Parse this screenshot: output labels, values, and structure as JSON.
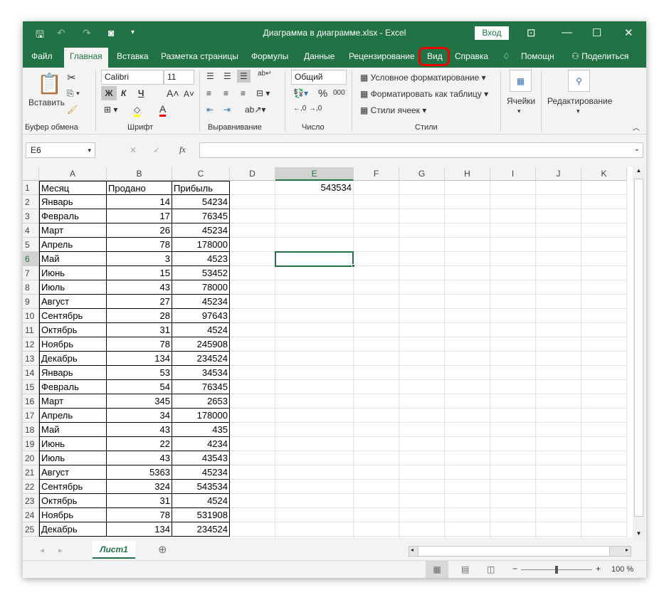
{
  "title": "Диаграмма в диаграмме.xlsx  -  Excel",
  "login": "Вход",
  "tabs": [
    "Файл",
    "Главная",
    "Вставка",
    "Разметка страницы",
    "Формулы",
    "Данные",
    "Рецензирование",
    "Вид",
    "Справка",
    "Помощн",
    "Поделиться"
  ],
  "ribbon": {
    "paste": "Вставить",
    "clipboard": "Буфер обмена",
    "font_name": "Calibri",
    "font_size": "11",
    "bold": "Ж",
    "italic": "К",
    "underline": "Ч",
    "font": "Шрифт",
    "alignment": "Выравнивание",
    "number_format": "Общий",
    "number": "Число",
    "percent": "%",
    "thousands": "000",
    "cond_format": "Условное форматирование",
    "format_table": "Форматировать как таблицу",
    "cell_styles": "Стили ячеек",
    "styles": "Стили",
    "cells": "Ячейки",
    "editing": "Редактирование"
  },
  "name_box": "E6",
  "fx": "fx",
  "columns": [
    "A",
    "B",
    "C",
    "D",
    "E",
    "F",
    "G",
    "H",
    "I",
    "J",
    "K"
  ],
  "header_row": [
    "Месяц",
    "Продано",
    "Прибыль"
  ],
  "rows": [
    [
      "Январь",
      14,
      54234
    ],
    [
      "Февраль",
      17,
      76345
    ],
    [
      "Март",
      26,
      45234
    ],
    [
      "Апрель",
      78,
      178000
    ],
    [
      "Май",
      3,
      4523
    ],
    [
      "Июнь",
      15,
      53452
    ],
    [
      "Июль",
      43,
      78000
    ],
    [
      "Август",
      27,
      45234
    ],
    [
      "Сентябрь",
      28,
      97643
    ],
    [
      "Октябрь",
      31,
      4524
    ],
    [
      "Ноябрь",
      78,
      245908
    ],
    [
      "Декабрь",
      134,
      234524
    ],
    [
      "Январь",
      53,
      34534
    ],
    [
      "Февраль",
      54,
      76345
    ],
    [
      "Март",
      345,
      2653
    ],
    [
      "Апрель",
      34,
      178000
    ],
    [
      "Май",
      43,
      435
    ],
    [
      "Июнь",
      22,
      4234
    ],
    [
      "Июль",
      43,
      43543
    ],
    [
      "Август",
      5363,
      45234
    ],
    [
      "Сентябрь",
      324,
      543534
    ],
    [
      "Октябрь",
      31,
      4524
    ],
    [
      "Ноябрь",
      78,
      531908
    ],
    [
      "Декабрь",
      134,
      234524
    ]
  ],
  "e1": "543534",
  "sheet": "Лист1",
  "zoom": "100 %",
  "colors": {
    "accent": "#217346",
    "highlight": "#e00000"
  }
}
